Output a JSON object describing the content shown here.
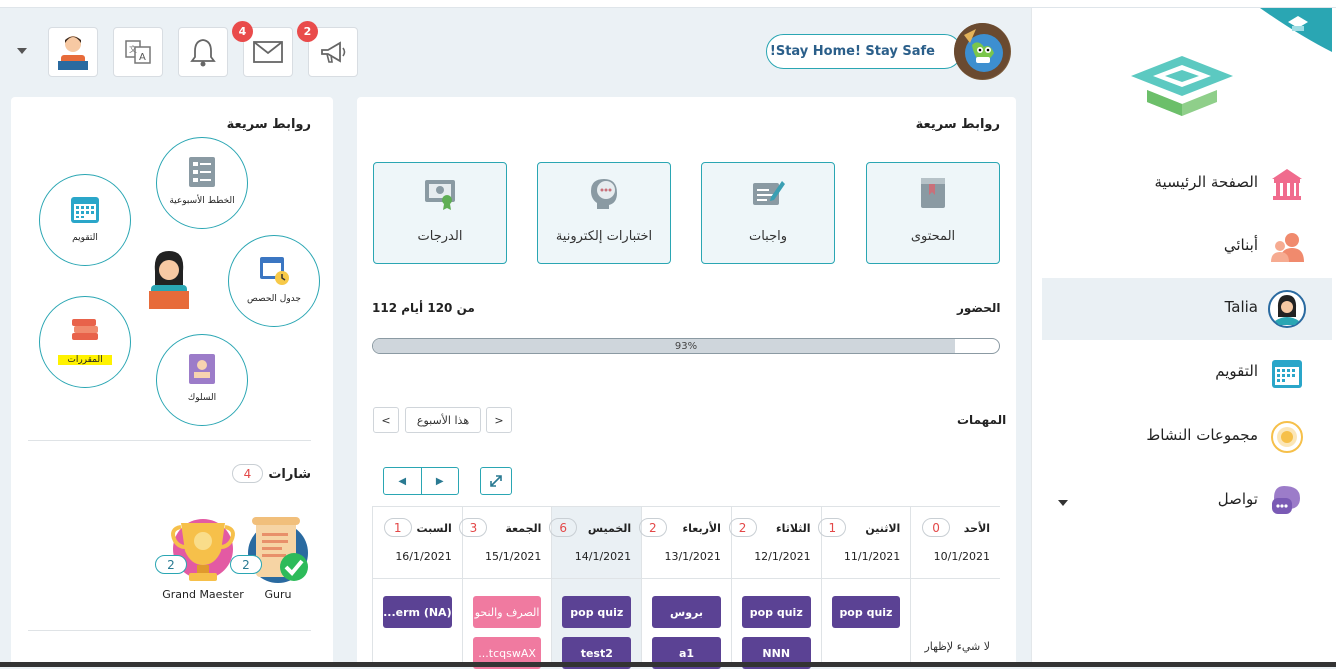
{
  "header": {
    "stay_home": "!Stay Home! Stay Safe",
    "announcements_count": "2",
    "messages_count": "4"
  },
  "main": {
    "quick_links_title": "روابط سريعة",
    "quick_links": [
      {
        "label": "المحتوى",
        "icon": "book-icon"
      },
      {
        "label": "واجبات",
        "icon": "homework-icon"
      },
      {
        "label": "اختبارات إلكترونية",
        "icon": "quiz-icon"
      },
      {
        "label": "الدرجات",
        "icon": "grades-certificate-icon"
      }
    ],
    "attendance_label": "الحضور",
    "attendance_value": "112 من 120 أيام",
    "attendance_percent_text": "93%",
    "attendance_percent": 93,
    "tasks_label": "المهمات",
    "this_week": "هذا الأسبوع",
    "days": [
      {
        "name": "الأحد",
        "count": "0",
        "date": "10/1/2021",
        "events": [],
        "empty_text": "لا شيء لإظهار"
      },
      {
        "name": "الاثنين",
        "count": "1",
        "date": "11/1/2021",
        "events": [
          {
            "t": "pop quiz",
            "c": "p"
          }
        ]
      },
      {
        "name": "الثلاثاء",
        "count": "2",
        "date": "12/1/2021",
        "events": [
          {
            "t": "pop quiz",
            "c": "p"
          },
          {
            "t": "NNN",
            "c": "p"
          }
        ]
      },
      {
        "name": "الأربعاء",
        "count": "2",
        "date": "13/1/2021",
        "events": [
          {
            "t": "بروس",
            "c": "p"
          },
          {
            "t": "a1",
            "c": "p"
          }
        ]
      },
      {
        "name": "الخميس",
        "count": "6",
        "date": "14/1/2021",
        "events": [
          {
            "t": "pop quiz",
            "c": "p"
          },
          {
            "t": "test2",
            "c": "p"
          }
        ],
        "today": true
      },
      {
        "name": "الجمعة",
        "count": "3",
        "date": "15/1/2021",
        "events": [
          {
            "t": "الصرف والنحو",
            "c": "k"
          },
          {
            "t": "...tcqswAX",
            "c": "k"
          }
        ]
      },
      {
        "name": "السبت",
        "count": "1",
        "date": "16/1/2021",
        "events": [
          {
            "t": "...erm (NA)",
            "c": "p"
          }
        ]
      }
    ]
  },
  "left": {
    "quick_links_title": "روابط سريعة",
    "links": [
      {
        "label": "الخطط الأسبوعية",
        "icon": "weekly-plan-icon"
      },
      {
        "label": "التقويم",
        "icon": "calendar-icon"
      },
      {
        "label": "جدول الحصص",
        "icon": "timetable-icon"
      },
      {
        "label": "المقررات",
        "icon": "courses-icon"
      },
      {
        "label": "السلوك",
        "icon": "behavior-icon"
      }
    ],
    "badges_title": "شارات",
    "badges_count": "4",
    "badges": [
      {
        "name": "Guru",
        "count": "2"
      },
      {
        "name": "Grand Maester",
        "count": "2"
      }
    ]
  },
  "sidebar": {
    "items": [
      {
        "label": "الصفحة الرئيسية",
        "icon": "home-icon"
      },
      {
        "label": "أبنائي",
        "icon": "children-icon"
      },
      {
        "label": "Talia",
        "icon": "student-avatar-icon",
        "active": true
      },
      {
        "label": "التقويم",
        "icon": "calendar-icon"
      },
      {
        "label": "مجموعات النشاط",
        "icon": "activity-groups-icon"
      },
      {
        "label": "تواصل",
        "icon": "chat-icon"
      }
    ]
  },
  "colors": {
    "accent": "#2aa6b3",
    "purple": "#5b4294",
    "pink": "#f07aa0",
    "badge_red": "#e94b4b"
  }
}
